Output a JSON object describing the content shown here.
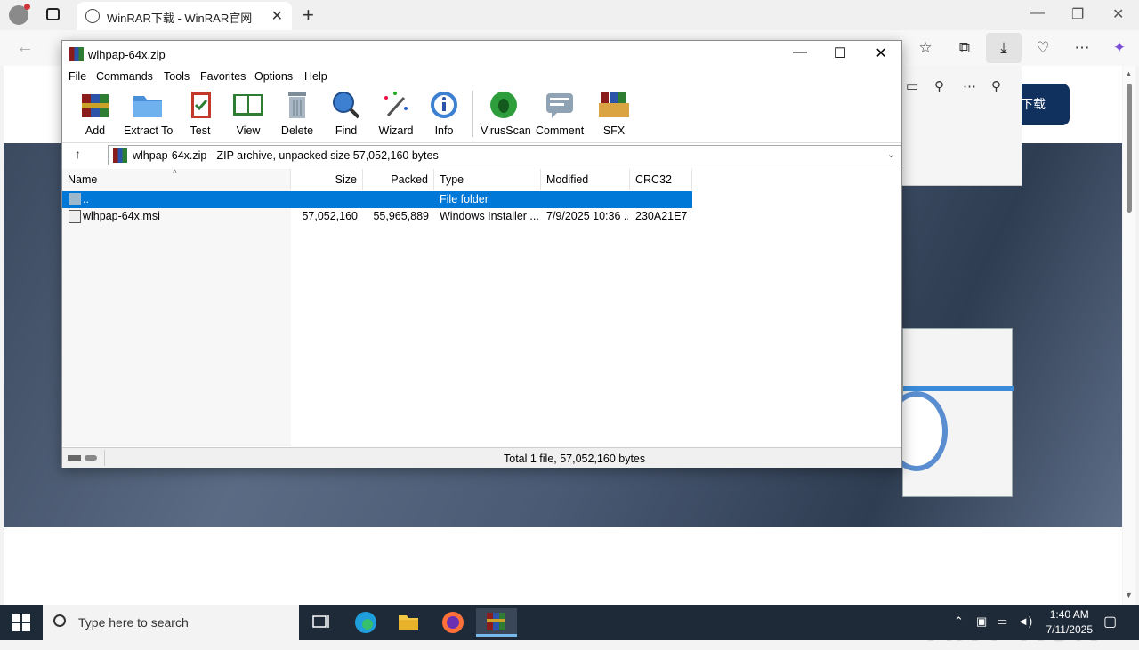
{
  "browser": {
    "tab_title": "WinRAR下载 - WinRAR官网",
    "tab_close": "✕",
    "new_tab": "+",
    "minimize": "—",
    "restore": "❐",
    "close": "✕",
    "back": "←"
  },
  "webpage": {
    "download_button": "下载",
    "watermark": "ANY RUN"
  },
  "winrar": {
    "title": "wlhpap-64x.zip",
    "window_controls": {
      "minimize": "—",
      "maximize": "☐",
      "close": "✕"
    },
    "menu": [
      "File",
      "Commands",
      "Tools",
      "Favorites",
      "Options",
      "Help"
    ],
    "toolbar": [
      "Add",
      "Extract To",
      "Test",
      "View",
      "Delete",
      "Find",
      "Wizard",
      "Info",
      "VirusScan",
      "Comment",
      "SFX"
    ],
    "path": "wlhpap-64x.zip - ZIP archive, unpacked size 57,052,160 bytes",
    "up_arrow": "↑",
    "dropdown": "⌄",
    "columns": [
      "Name",
      "Size",
      "Packed",
      "Type",
      "Modified",
      "CRC32"
    ],
    "sort_indicator": "^",
    "rows": [
      {
        "name": "..",
        "size": "",
        "packed": "",
        "type": "File folder",
        "modified": "",
        "crc": "",
        "selected": true
      },
      {
        "name": "wlhpap-64x.msi",
        "size": "57,052,160",
        "packed": "55,965,889",
        "type": "Windows Installer ...",
        "modified": "7/9/2025 10:36 ...",
        "crc": "230A21E7",
        "selected": false
      }
    ],
    "status": "Total 1 file, 57,052,160 bytes"
  },
  "taskbar": {
    "search_placeholder": "Type here to search",
    "time": "1:40 AM",
    "date": "7/11/2025"
  }
}
